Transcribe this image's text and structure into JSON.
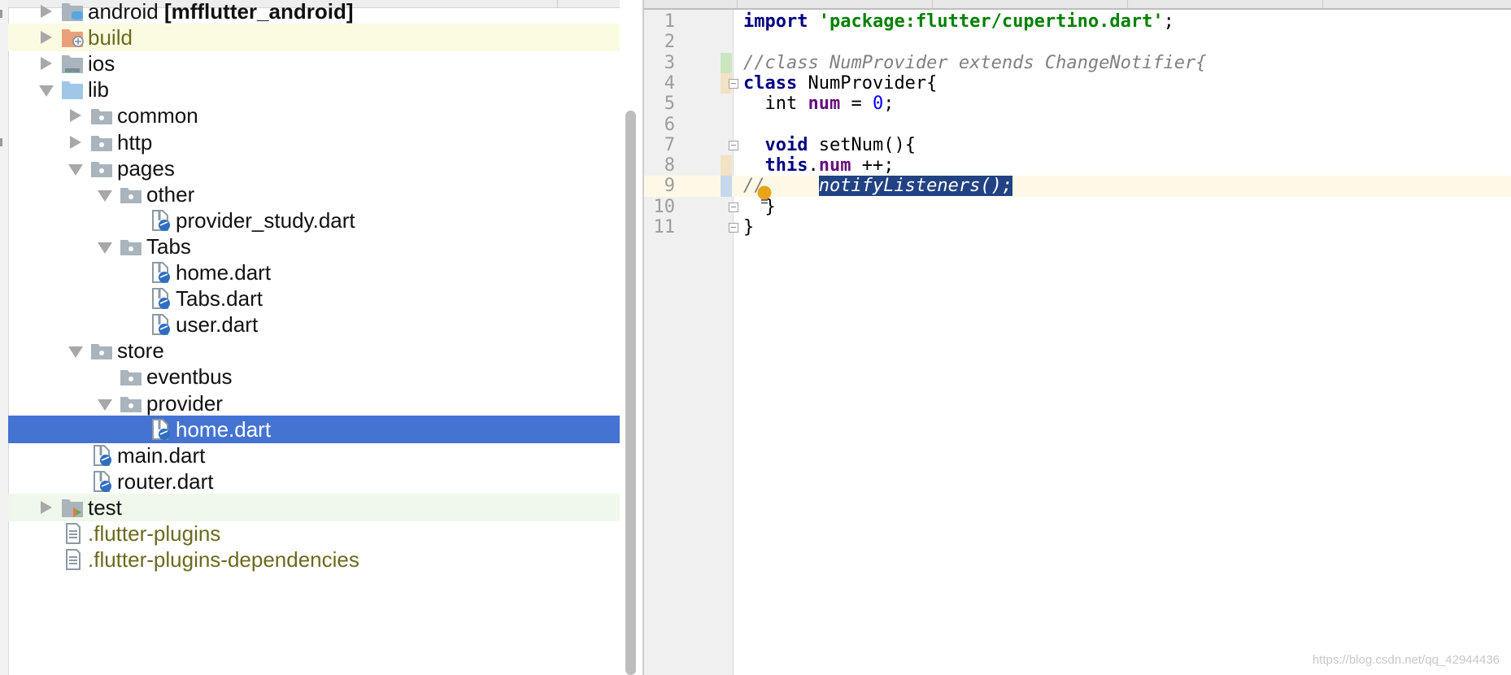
{
  "project_tree": {
    "items": [
      {
        "name": "android",
        "suffix": " [mfflutter_android]",
        "level": 0,
        "expanded": false,
        "type": "folder-android",
        "highlight": "none"
      },
      {
        "name": "build",
        "suffix": "",
        "level": 0,
        "expanded": false,
        "type": "folder-build",
        "highlight": "yellow"
      },
      {
        "name": "ios",
        "suffix": "",
        "level": 0,
        "expanded": false,
        "type": "folder-ios",
        "highlight": "none"
      },
      {
        "name": "lib",
        "suffix": "",
        "level": 0,
        "expanded": true,
        "type": "folder-source",
        "highlight": "none"
      },
      {
        "name": "common",
        "suffix": "",
        "level": 1,
        "expanded": false,
        "type": "package",
        "highlight": "none"
      },
      {
        "name": "http",
        "suffix": "",
        "level": 1,
        "expanded": false,
        "type": "package",
        "highlight": "none"
      },
      {
        "name": "pages",
        "suffix": "",
        "level": 1,
        "expanded": true,
        "type": "package",
        "highlight": "none"
      },
      {
        "name": "other",
        "suffix": "",
        "level": 2,
        "expanded": true,
        "type": "package",
        "highlight": "none"
      },
      {
        "name": "provider_study.dart",
        "suffix": "",
        "level": 3,
        "type": "dart-file",
        "highlight": "none"
      },
      {
        "name": "Tabs",
        "suffix": "",
        "level": 2,
        "expanded": true,
        "type": "package",
        "highlight": "none"
      },
      {
        "name": "home.dart",
        "suffix": "",
        "level": 3,
        "type": "dart-file",
        "highlight": "none"
      },
      {
        "name": "Tabs.dart",
        "suffix": "",
        "level": 3,
        "type": "dart-file",
        "highlight": "none"
      },
      {
        "name": "user.dart",
        "suffix": "",
        "level": 3,
        "type": "dart-file",
        "highlight": "none"
      },
      {
        "name": "store",
        "suffix": "",
        "level": 1,
        "expanded": true,
        "type": "package",
        "highlight": "none"
      },
      {
        "name": "eventbus",
        "suffix": "",
        "level": 2,
        "type": "package-leaf",
        "highlight": "none"
      },
      {
        "name": "provider",
        "suffix": "",
        "level": 2,
        "expanded": true,
        "type": "package",
        "highlight": "none"
      },
      {
        "name": "home.dart",
        "suffix": "",
        "level": 3,
        "type": "dart-file",
        "highlight": "selected"
      },
      {
        "name": "main.dart",
        "suffix": "",
        "level": 1,
        "type": "dart-file",
        "highlight": "none"
      },
      {
        "name": "router.dart",
        "suffix": "",
        "level": 1,
        "type": "dart-file",
        "highlight": "none"
      },
      {
        "name": "test",
        "suffix": "",
        "level": 0,
        "expanded": false,
        "type": "folder-test",
        "highlight": "green"
      },
      {
        "name": ".flutter-plugins",
        "suffix": "",
        "level": 0,
        "type": "text-file",
        "highlight": "olive"
      },
      {
        "name": ".flutter-plugins-dependencies",
        "suffix": "",
        "level": 0,
        "type": "text-file",
        "highlight": "olive"
      }
    ]
  },
  "editor": {
    "line_numbers": [
      "1",
      "2",
      "3",
      "4",
      "5",
      "6",
      "7",
      "8",
      "9",
      "10",
      "11"
    ],
    "lines": [
      [
        {
          "t": "import",
          "c": "kw"
        },
        {
          "t": " ",
          "c": ""
        },
        {
          "t": "'package:flutter/cupertino.dart'",
          "c": "str"
        },
        {
          "t": ";",
          "c": ""
        }
      ],
      [],
      [
        {
          "t": "//class NumProvider extends ChangeNotifier{",
          "c": "cmt"
        }
      ],
      [
        {
          "t": "class",
          "c": "kw"
        },
        {
          "t": " NumProvider{",
          "c": ""
        }
      ],
      [
        {
          "t": "  int ",
          "c": ""
        },
        {
          "t": "num",
          "c": "fld"
        },
        {
          "t": " = ",
          "c": ""
        },
        {
          "t": "0",
          "c": "num"
        },
        {
          "t": ";",
          "c": ""
        }
      ],
      [],
      [
        {
          "t": "  ",
          "c": ""
        },
        {
          "t": "void",
          "c": "kw"
        },
        {
          "t": " setNum(){",
          "c": ""
        }
      ],
      [
        {
          "t": "  ",
          "c": ""
        },
        {
          "t": "this",
          "c": "kw"
        },
        {
          "t": ".",
          "c": ""
        },
        {
          "t": "num",
          "c": "fld"
        },
        {
          "t": " ++;",
          "c": ""
        }
      ],
      [
        {
          "t": "//     ",
          "c": "cmt"
        },
        {
          "t": "notifyListeners();",
          "c": "cmt sel"
        }
      ],
      [
        {
          "t": "  }",
          "c": ""
        }
      ],
      [
        {
          "t": "}",
          "c": ""
        }
      ]
    ],
    "caret_line": 9
  },
  "watermark": "https://blog.csdn.net/qq_42944436",
  "colors": {
    "selection": "#4573d2",
    "build_highlight": "#fbfbe2",
    "test_highlight": "#eff8ea",
    "olive_text": "#6b6a1f"
  }
}
